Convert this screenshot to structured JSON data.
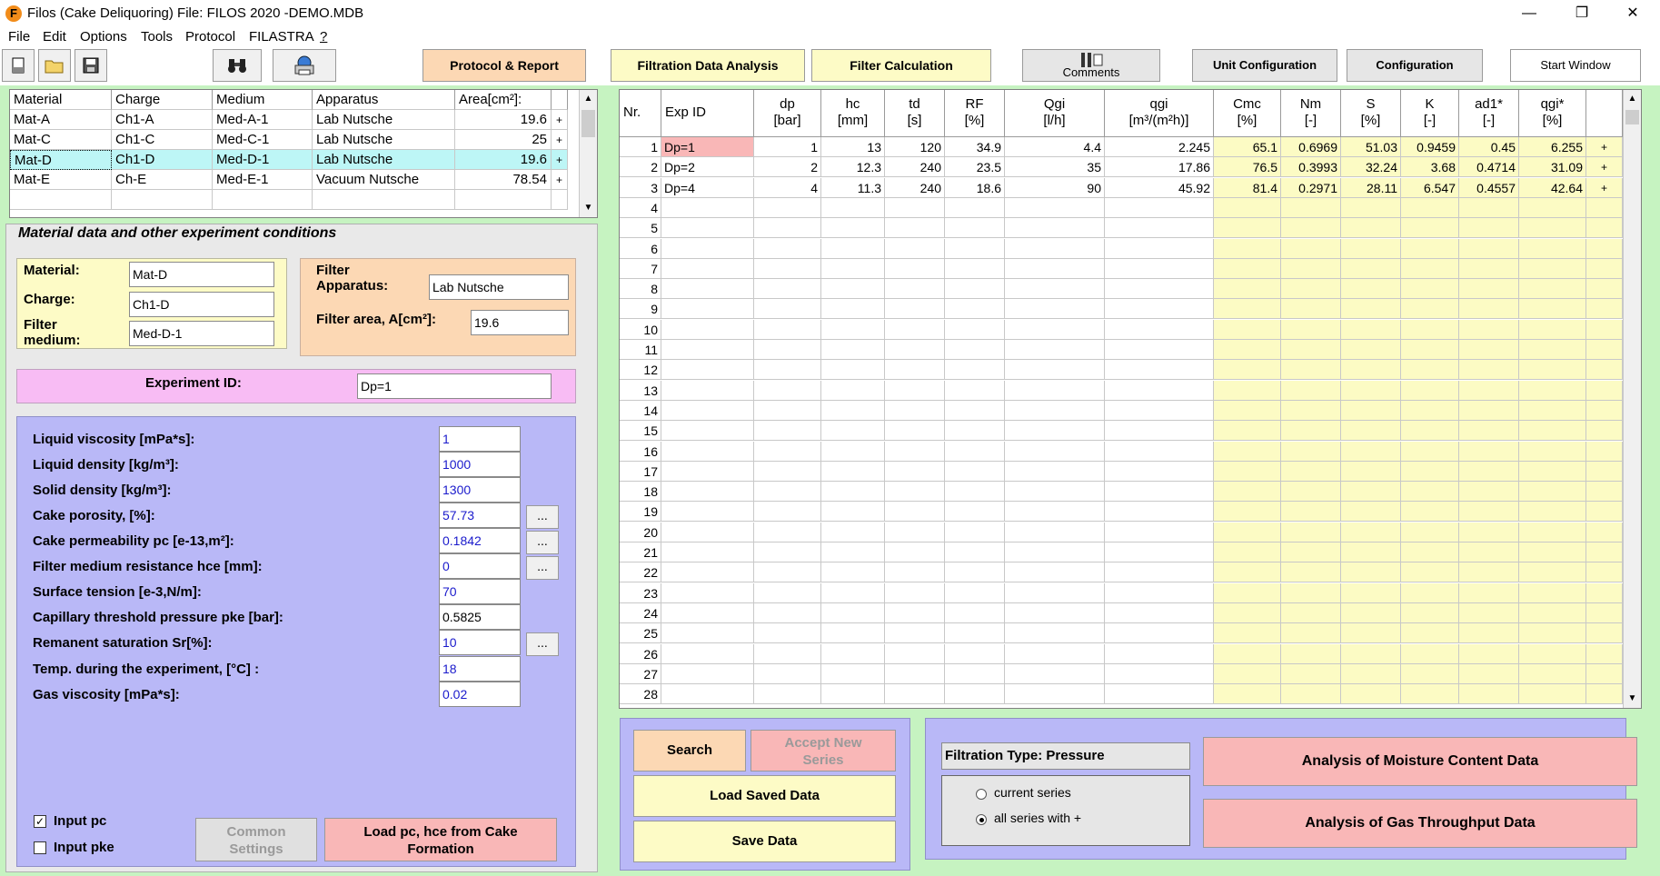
{
  "window": {
    "title": "Filos (Cake Deliquoring)   File: FILOS 2020 -DEMO.MDB",
    "minimize": "—",
    "maximize": "❐",
    "close": "✕",
    "icon_letter": "F"
  },
  "menu": [
    "File",
    "Edit",
    "Options",
    "Tools",
    "Protocol",
    "FILASTRA",
    "?"
  ],
  "toolbar": {
    "protocol_report": "Protocol & Report",
    "filtration_data_analysis": "Filtration Data Analysis",
    "filter_calculation": "Filter Calculation",
    "comments": "Comments",
    "unit_configuration": "Unit Configuration",
    "configuration": "Configuration",
    "start_window": "Start Window"
  },
  "colors": {
    "frame_green": "#c6f3c1",
    "peach": "#fcd8b4",
    "yellow": "#fdfbc6",
    "lavender": "#b9b8f7",
    "pink": "#f8bcf4",
    "salmon": "#f9b7b7",
    "selected_cyan": "#bdf6f6"
  },
  "materials_table": {
    "headers": [
      "Material",
      "Charge",
      "Medium",
      "Apparatus",
      "Area[cm²]:"
    ],
    "rows": [
      {
        "material": "Mat-A",
        "charge": "Ch1-A",
        "medium": "Med-A-1",
        "apparatus": "Lab Nutsche",
        "area": "19.6",
        "flag": "+"
      },
      {
        "material": "Mat-C",
        "charge": "Ch1-C",
        "medium": "Med-C-1",
        "apparatus": "Lab  Nutsche",
        "area": "25",
        "flag": "+"
      },
      {
        "material": "Mat-D",
        "charge": "Ch1-D",
        "medium": "Med-D-1",
        "apparatus": "Lab Nutsche",
        "area": "19.6",
        "flag": "+"
      },
      {
        "material": "Mat-E",
        "charge": "Ch-E",
        "medium": "Med-E-1",
        "apparatus": "Vacuum  Nutsche",
        "area": "78.54",
        "flag": "+"
      }
    ],
    "selected_index": 2
  },
  "material_panel": {
    "title": "Material data and  other experiment conditions",
    "material_label": "Material:",
    "material_value": "Mat-D",
    "charge_label": "Charge:",
    "charge_value": "Ch1-D",
    "medium_label": "Filter\nmedium:",
    "medium_value": "Med-D-1",
    "apparatus_label": "Filter\nApparatus:",
    "apparatus_value": "Lab Nutsche",
    "area_label": "Filter area, A[cm²]:",
    "area_value": "19.6",
    "experiment_id_label": "Experiment ID:",
    "experiment_id_value": "Dp=1"
  },
  "parameters": [
    {
      "label": "Liquid viscosity [mPa*s]:",
      "value": "1",
      "blue": true,
      "dots": false
    },
    {
      "label": "Liquid density [kg/m³]:",
      "value": "1000",
      "blue": true,
      "dots": false
    },
    {
      "label": "Solid density [kg/m³]:",
      "value": "1300",
      "blue": true,
      "dots": false
    },
    {
      "label": "Cake porosity, [%]:",
      "value": "57.73",
      "blue": true,
      "dots": true
    },
    {
      "label": "Cake permeability  pc [e-13,m²]:",
      "value": "0.1842",
      "blue": true,
      "dots": true
    },
    {
      "label": "Filter medium resistance hce [mm]:",
      "value": "0",
      "blue": true,
      "dots": true
    },
    {
      "label": "Surface tension [e-3,N/m]:",
      "value": "70",
      "blue": true,
      "dots": false
    },
    {
      "label": "Capillary threshold pressure pke [bar]:",
      "value": "0.5825",
      "blue": false,
      "dots": false
    },
    {
      "label": "Remanent saturation Sr[%]:",
      "value": "10",
      "blue": true,
      "dots": true
    },
    {
      "label": "Temp. during the experiment, [°C] :",
      "value": "18",
      "blue": true,
      "dots": false
    },
    {
      "label": "Gas viscosity [mPa*s]:",
      "value": "0.02",
      "blue": true,
      "dots": false
    }
  ],
  "dots_label": "...",
  "checkboxes": {
    "input_pc_label": "Input pc",
    "input_pc_checked": true,
    "input_pke_label": "Input pke",
    "input_pke_checked": false
  },
  "buttons": {
    "common_settings": "Common\nSettings",
    "load_pc_hce": "Load pc, hce from Cake\nFormation",
    "search": "Search",
    "accept_new_series": "Accept New\nSeries",
    "load_saved_data": "Load Saved Data",
    "save_data": "Save Data",
    "analysis_moisture": "Analysis of Moisture Content Data",
    "analysis_gas": "Analysis of Gas Throughput Data"
  },
  "filtration": {
    "type_label": "Filtration Type: Pressure",
    "radio_current": "current series",
    "radio_all": "all series with +",
    "selected": "all"
  },
  "grid": {
    "headers": [
      {
        "top": "Nr.",
        "bottom": ""
      },
      {
        "top": "Exp ID",
        "bottom": ""
      },
      {
        "top": "dp",
        "bottom": "[bar]"
      },
      {
        "top": "hc",
        "bottom": "[mm]"
      },
      {
        "top": "td",
        "bottom": "[s]"
      },
      {
        "top": "RF",
        "bottom": "[%]"
      },
      {
        "top": "Qgi",
        "bottom": "[l/h]"
      },
      {
        "top": "qgi",
        "bottom": "[m³/(m²h)]"
      },
      {
        "top": "Cmc",
        "bottom": "[%]"
      },
      {
        "top": "Nm",
        "bottom": "[-]"
      },
      {
        "top": "S",
        "bottom": "[%]"
      },
      {
        "top": "K",
        "bottom": "[-]"
      },
      {
        "top": "ad1*",
        "bottom": "[-]"
      },
      {
        "top": "qgi*",
        "bottom": "[%]"
      },
      {
        "top": "",
        "bottom": ""
      }
    ],
    "row_numbers": [
      "1",
      "2",
      "3",
      "4",
      "5",
      "6",
      "7",
      "8",
      "9",
      "10",
      "11",
      "12",
      "13",
      "14",
      "15",
      "16",
      "17",
      "18",
      "19",
      "20",
      "21",
      "22",
      "23",
      "24",
      "25",
      "26",
      "27",
      "28"
    ],
    "rows": [
      [
        "Dp=1",
        "1",
        "13",
        "120",
        "34.9",
        "4.4",
        "2.245",
        "65.1",
        "0.6969",
        "51.03",
        "0.9459",
        "0.45",
        "6.255",
        "+"
      ],
      [
        "Dp=2",
        "2",
        "12.3",
        "240",
        "23.5",
        "35",
        "17.86",
        "76.5",
        "0.3993",
        "32.24",
        "3.68",
        "0.4714",
        "31.09",
        "+"
      ],
      [
        "Dp=4",
        "4",
        "11.3",
        "240",
        "18.6",
        "90",
        "45.92",
        "81.4",
        "0.2971",
        "28.11",
        "6.547",
        "0.4557",
        "42.64",
        "+"
      ]
    ]
  }
}
